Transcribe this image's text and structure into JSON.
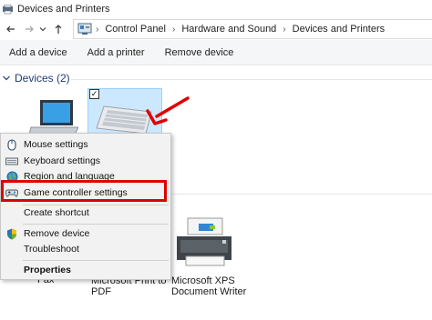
{
  "window": {
    "title": "Devices and Printers"
  },
  "breadcrumb": {
    "items": [
      "Control Panel",
      "Hardware and Sound",
      "Devices and Printers"
    ]
  },
  "toolbar": {
    "add_device": "Add a device",
    "add_printer": "Add a printer",
    "remove_device": "Remove device"
  },
  "devices_group": {
    "header": "Devices (2)"
  },
  "printers": [
    {
      "name_line1": "Fax",
      "name_line2": ""
    },
    {
      "name_line1": "Microsoft Print to",
      "name_line2": "PDF"
    },
    {
      "name_line1": "Microsoft XPS",
      "name_line2": "Document Writer"
    }
  ],
  "context_menu": {
    "items": [
      {
        "label": "Mouse settings",
        "icon": "mouse-icon"
      },
      {
        "label": "Keyboard settings",
        "icon": "keyboard-icon"
      },
      {
        "label": "Region and language",
        "icon": "globe-icon"
      },
      {
        "label": "Game controller settings",
        "icon": "gamepad-icon"
      },
      {
        "label": "Create shortcut",
        "icon": ""
      },
      {
        "label": "Remove device",
        "icon": "shield-icon"
      },
      {
        "label": "Troubleshoot",
        "icon": ""
      },
      {
        "label": "Properties",
        "icon": ""
      }
    ]
  },
  "colors": {
    "highlight_box": "#e00000",
    "selection": "#cce8ff",
    "group_header": "#1e3c78"
  }
}
